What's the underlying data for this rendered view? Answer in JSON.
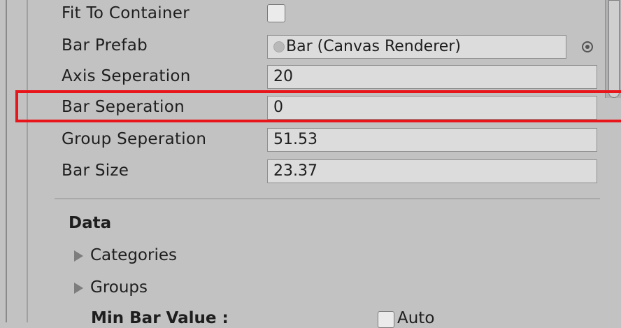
{
  "fields": {
    "fit_to_container": {
      "label": "Fit To Container",
      "checked": false
    },
    "bar_prefab": {
      "label": "Bar Prefab",
      "value": "Bar (Canvas Renderer)"
    },
    "axis_separation": {
      "label": "Axis Seperation",
      "value": "20"
    },
    "bar_separation": {
      "label": "Bar Seperation",
      "value": "0"
    },
    "group_separation": {
      "label": "Group Seperation",
      "value": "51.53"
    },
    "bar_size": {
      "label": "Bar Size",
      "value": "23.37"
    }
  },
  "data_section": {
    "title": "Data",
    "foldouts": [
      "Categories",
      "Groups"
    ],
    "min_bar_value_label": "Min Bar Value :",
    "auto_label": "Auto",
    "auto_checked": false
  },
  "highlight_color": "#e8151b"
}
